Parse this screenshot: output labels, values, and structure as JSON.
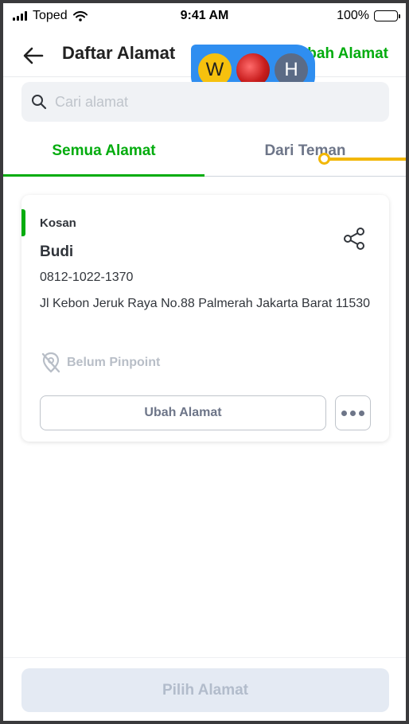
{
  "status_bar": {
    "carrier": "Toped",
    "time": "9:41 AM",
    "battery": "100%"
  },
  "header": {
    "title": "Daftar Alamat",
    "action_label": "Tambah Alamat"
  },
  "collaborators": [
    "W",
    "",
    "H"
  ],
  "search": {
    "placeholder": "Cari alamat",
    "value": ""
  },
  "tabs": [
    {
      "label": "Semua Alamat",
      "active": true
    },
    {
      "label": "Dari Teman",
      "active": false
    }
  ],
  "address_card": {
    "label": "Kosan",
    "name": "Budi",
    "phone": "0812-1022-1370",
    "address": "Jl Kebon Jeruk Raya No.88 Palmerah Jakarta Barat 11530",
    "pinpoint_status": "Belum Pinpoint",
    "edit_button": "Ubah Alamat"
  },
  "footer": {
    "primary_button": "Pilih Alamat"
  },
  "colors": {
    "brand_green": "#03ac0e",
    "text_primary": "#31353b",
    "text_secondary": "#6d7588",
    "disabled_bg": "#e4eaf3",
    "collab_blue": "#2f8ef0",
    "annotation_yellow": "#f2b705"
  }
}
